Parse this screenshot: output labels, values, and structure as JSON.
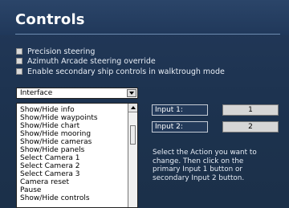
{
  "header": {
    "title": "Controls"
  },
  "options": [
    {
      "label": "Precision steering"
    },
    {
      "label": "Azimuth Arcade steering override"
    },
    {
      "label": "Enable secondary ship controls in walktrough mode"
    }
  ],
  "category": {
    "selected": "Interface"
  },
  "actions": [
    "Show/Hide info",
    "Show/Hide waypoints",
    "Show/Hide chart",
    "Show/Hide mooring",
    "Show/Hide cameras",
    "Show/Hide panels",
    "Select Camera 1",
    "Select Camera 2",
    "Select Camera 3",
    "Camera reset",
    "Pause",
    "Show/Hide controls"
  ],
  "inputs": [
    {
      "label": "Input 1:",
      "value": "1"
    },
    {
      "label": "Input 2:",
      "value": "2"
    }
  ],
  "help_text": "Select the Action you want to change. Then click on the primary Input 1 button or secondary Input 2 button."
}
